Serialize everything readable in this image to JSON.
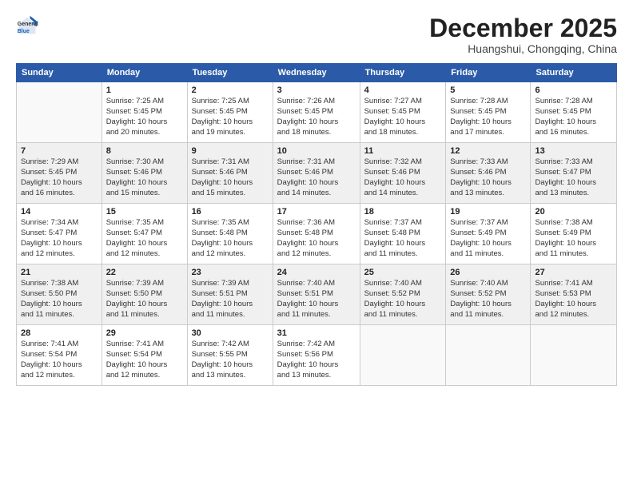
{
  "header": {
    "logo_line1": "General",
    "logo_line2": "Blue",
    "month": "December 2025",
    "location": "Huangshui, Chongqing, China"
  },
  "weekdays": [
    "Sunday",
    "Monday",
    "Tuesday",
    "Wednesday",
    "Thursday",
    "Friday",
    "Saturday"
  ],
  "weeks": [
    [
      {
        "day": "",
        "info": ""
      },
      {
        "day": "1",
        "info": "Sunrise: 7:25 AM\nSunset: 5:45 PM\nDaylight: 10 hours\nand 20 minutes."
      },
      {
        "day": "2",
        "info": "Sunrise: 7:25 AM\nSunset: 5:45 PM\nDaylight: 10 hours\nand 19 minutes."
      },
      {
        "day": "3",
        "info": "Sunrise: 7:26 AM\nSunset: 5:45 PM\nDaylight: 10 hours\nand 18 minutes."
      },
      {
        "day": "4",
        "info": "Sunrise: 7:27 AM\nSunset: 5:45 PM\nDaylight: 10 hours\nand 18 minutes."
      },
      {
        "day": "5",
        "info": "Sunrise: 7:28 AM\nSunset: 5:45 PM\nDaylight: 10 hours\nand 17 minutes."
      },
      {
        "day": "6",
        "info": "Sunrise: 7:28 AM\nSunset: 5:45 PM\nDaylight: 10 hours\nand 16 minutes."
      }
    ],
    [
      {
        "day": "7",
        "info": "Sunrise: 7:29 AM\nSunset: 5:45 PM\nDaylight: 10 hours\nand 16 minutes."
      },
      {
        "day": "8",
        "info": "Sunrise: 7:30 AM\nSunset: 5:46 PM\nDaylight: 10 hours\nand 15 minutes."
      },
      {
        "day": "9",
        "info": "Sunrise: 7:31 AM\nSunset: 5:46 PM\nDaylight: 10 hours\nand 15 minutes."
      },
      {
        "day": "10",
        "info": "Sunrise: 7:31 AM\nSunset: 5:46 PM\nDaylight: 10 hours\nand 14 minutes."
      },
      {
        "day": "11",
        "info": "Sunrise: 7:32 AM\nSunset: 5:46 PM\nDaylight: 10 hours\nand 14 minutes."
      },
      {
        "day": "12",
        "info": "Sunrise: 7:33 AM\nSunset: 5:46 PM\nDaylight: 10 hours\nand 13 minutes."
      },
      {
        "day": "13",
        "info": "Sunrise: 7:33 AM\nSunset: 5:47 PM\nDaylight: 10 hours\nand 13 minutes."
      }
    ],
    [
      {
        "day": "14",
        "info": "Sunrise: 7:34 AM\nSunset: 5:47 PM\nDaylight: 10 hours\nand 12 minutes."
      },
      {
        "day": "15",
        "info": "Sunrise: 7:35 AM\nSunset: 5:47 PM\nDaylight: 10 hours\nand 12 minutes."
      },
      {
        "day": "16",
        "info": "Sunrise: 7:35 AM\nSunset: 5:48 PM\nDaylight: 10 hours\nand 12 minutes."
      },
      {
        "day": "17",
        "info": "Sunrise: 7:36 AM\nSunset: 5:48 PM\nDaylight: 10 hours\nand 12 minutes."
      },
      {
        "day": "18",
        "info": "Sunrise: 7:37 AM\nSunset: 5:48 PM\nDaylight: 10 hours\nand 11 minutes."
      },
      {
        "day": "19",
        "info": "Sunrise: 7:37 AM\nSunset: 5:49 PM\nDaylight: 10 hours\nand 11 minutes."
      },
      {
        "day": "20",
        "info": "Sunrise: 7:38 AM\nSunset: 5:49 PM\nDaylight: 10 hours\nand 11 minutes."
      }
    ],
    [
      {
        "day": "21",
        "info": "Sunrise: 7:38 AM\nSunset: 5:50 PM\nDaylight: 10 hours\nand 11 minutes."
      },
      {
        "day": "22",
        "info": "Sunrise: 7:39 AM\nSunset: 5:50 PM\nDaylight: 10 hours\nand 11 minutes."
      },
      {
        "day": "23",
        "info": "Sunrise: 7:39 AM\nSunset: 5:51 PM\nDaylight: 10 hours\nand 11 minutes."
      },
      {
        "day": "24",
        "info": "Sunrise: 7:40 AM\nSunset: 5:51 PM\nDaylight: 10 hours\nand 11 minutes."
      },
      {
        "day": "25",
        "info": "Sunrise: 7:40 AM\nSunset: 5:52 PM\nDaylight: 10 hours\nand 11 minutes."
      },
      {
        "day": "26",
        "info": "Sunrise: 7:40 AM\nSunset: 5:52 PM\nDaylight: 10 hours\nand 11 minutes."
      },
      {
        "day": "27",
        "info": "Sunrise: 7:41 AM\nSunset: 5:53 PM\nDaylight: 10 hours\nand 12 minutes."
      }
    ],
    [
      {
        "day": "28",
        "info": "Sunrise: 7:41 AM\nSunset: 5:54 PM\nDaylight: 10 hours\nand 12 minutes."
      },
      {
        "day": "29",
        "info": "Sunrise: 7:41 AM\nSunset: 5:54 PM\nDaylight: 10 hours\nand 12 minutes."
      },
      {
        "day": "30",
        "info": "Sunrise: 7:42 AM\nSunset: 5:55 PM\nDaylight: 10 hours\nand 13 minutes."
      },
      {
        "day": "31",
        "info": "Sunrise: 7:42 AM\nSunset: 5:56 PM\nDaylight: 10 hours\nand 13 minutes."
      },
      {
        "day": "",
        "info": ""
      },
      {
        "day": "",
        "info": ""
      },
      {
        "day": "",
        "info": ""
      }
    ]
  ]
}
